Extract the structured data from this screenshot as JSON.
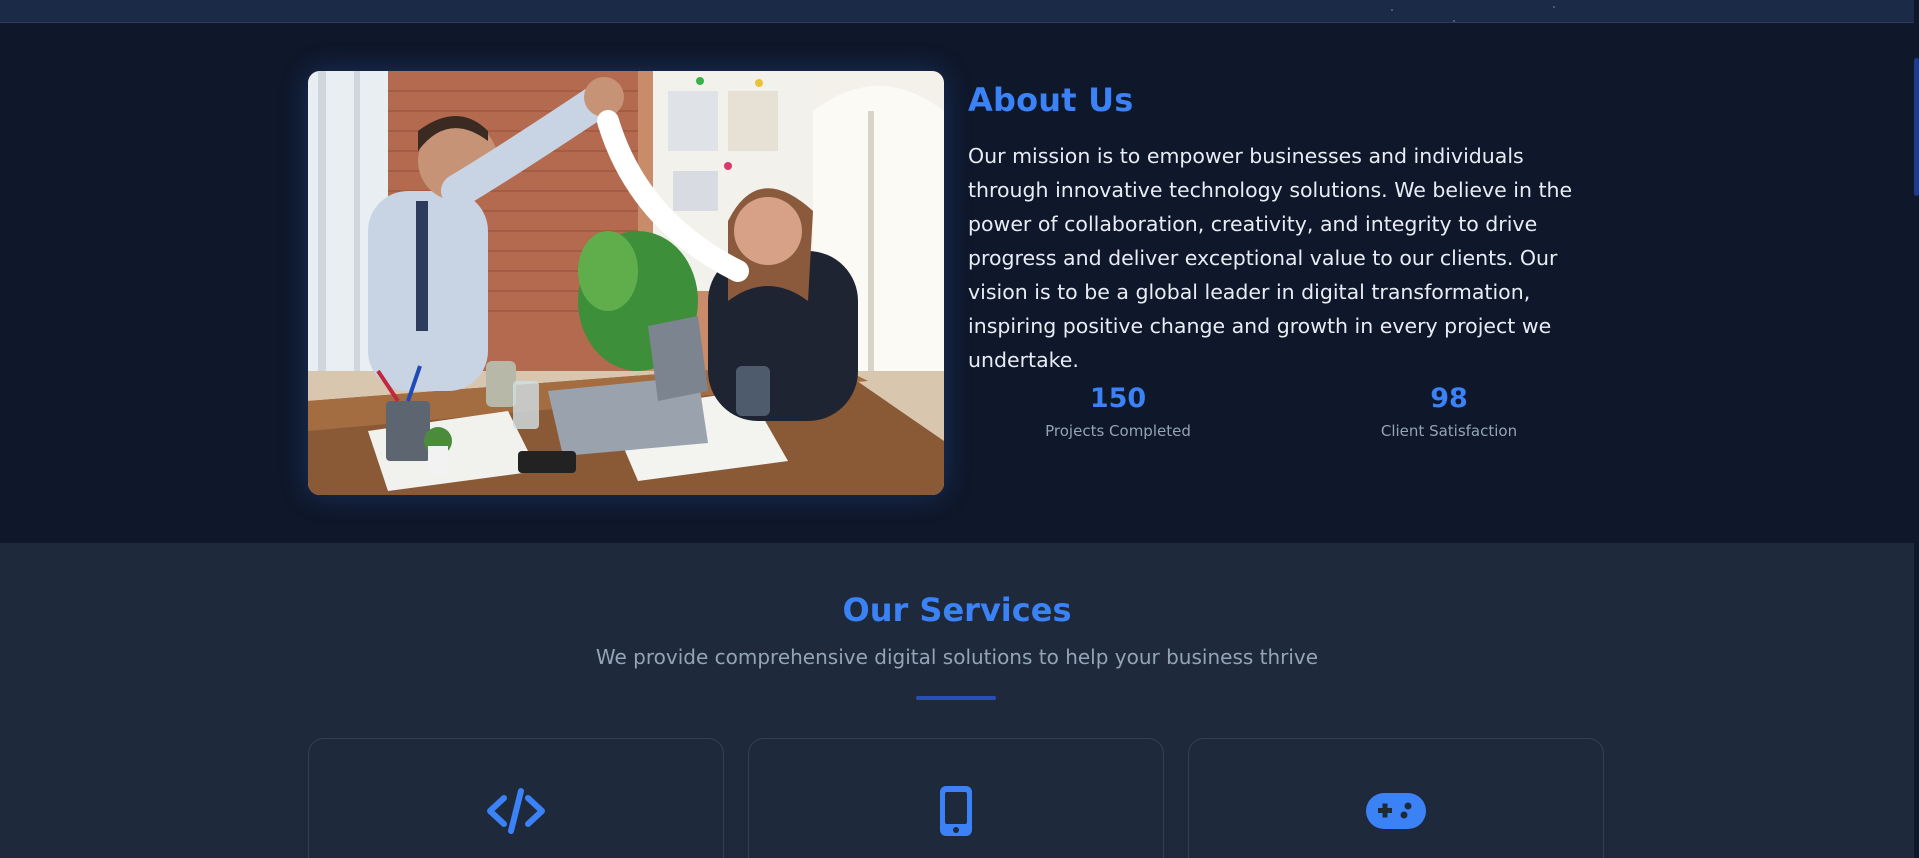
{
  "about": {
    "title": "About Us",
    "paragraph": "Our mission is to empower businesses and individuals through innovative technology solutions. We believe in the power of collaboration, creativity, and integrity to drive progress and deliver exceptional value to our clients. Our vision is to be a global leader in digital transformation, inspiring positive change and growth in every project we undertake.",
    "stats": [
      {
        "value": "150",
        "label": "Projects Completed"
      },
      {
        "value": "98",
        "label": "Client Satisfaction"
      }
    ]
  },
  "services": {
    "title": "Our Services",
    "subtitle": "We provide comprehensive digital solutions to help your business thrive",
    "cards": [
      {
        "icon": "code-icon"
      },
      {
        "icon": "mobile-icon"
      },
      {
        "icon": "gamepad-icon"
      }
    ]
  },
  "colors": {
    "accent": "#3b82f6",
    "background_dark": "#0f172a",
    "background_section": "#1e293b",
    "muted_text": "#94a3b8"
  }
}
